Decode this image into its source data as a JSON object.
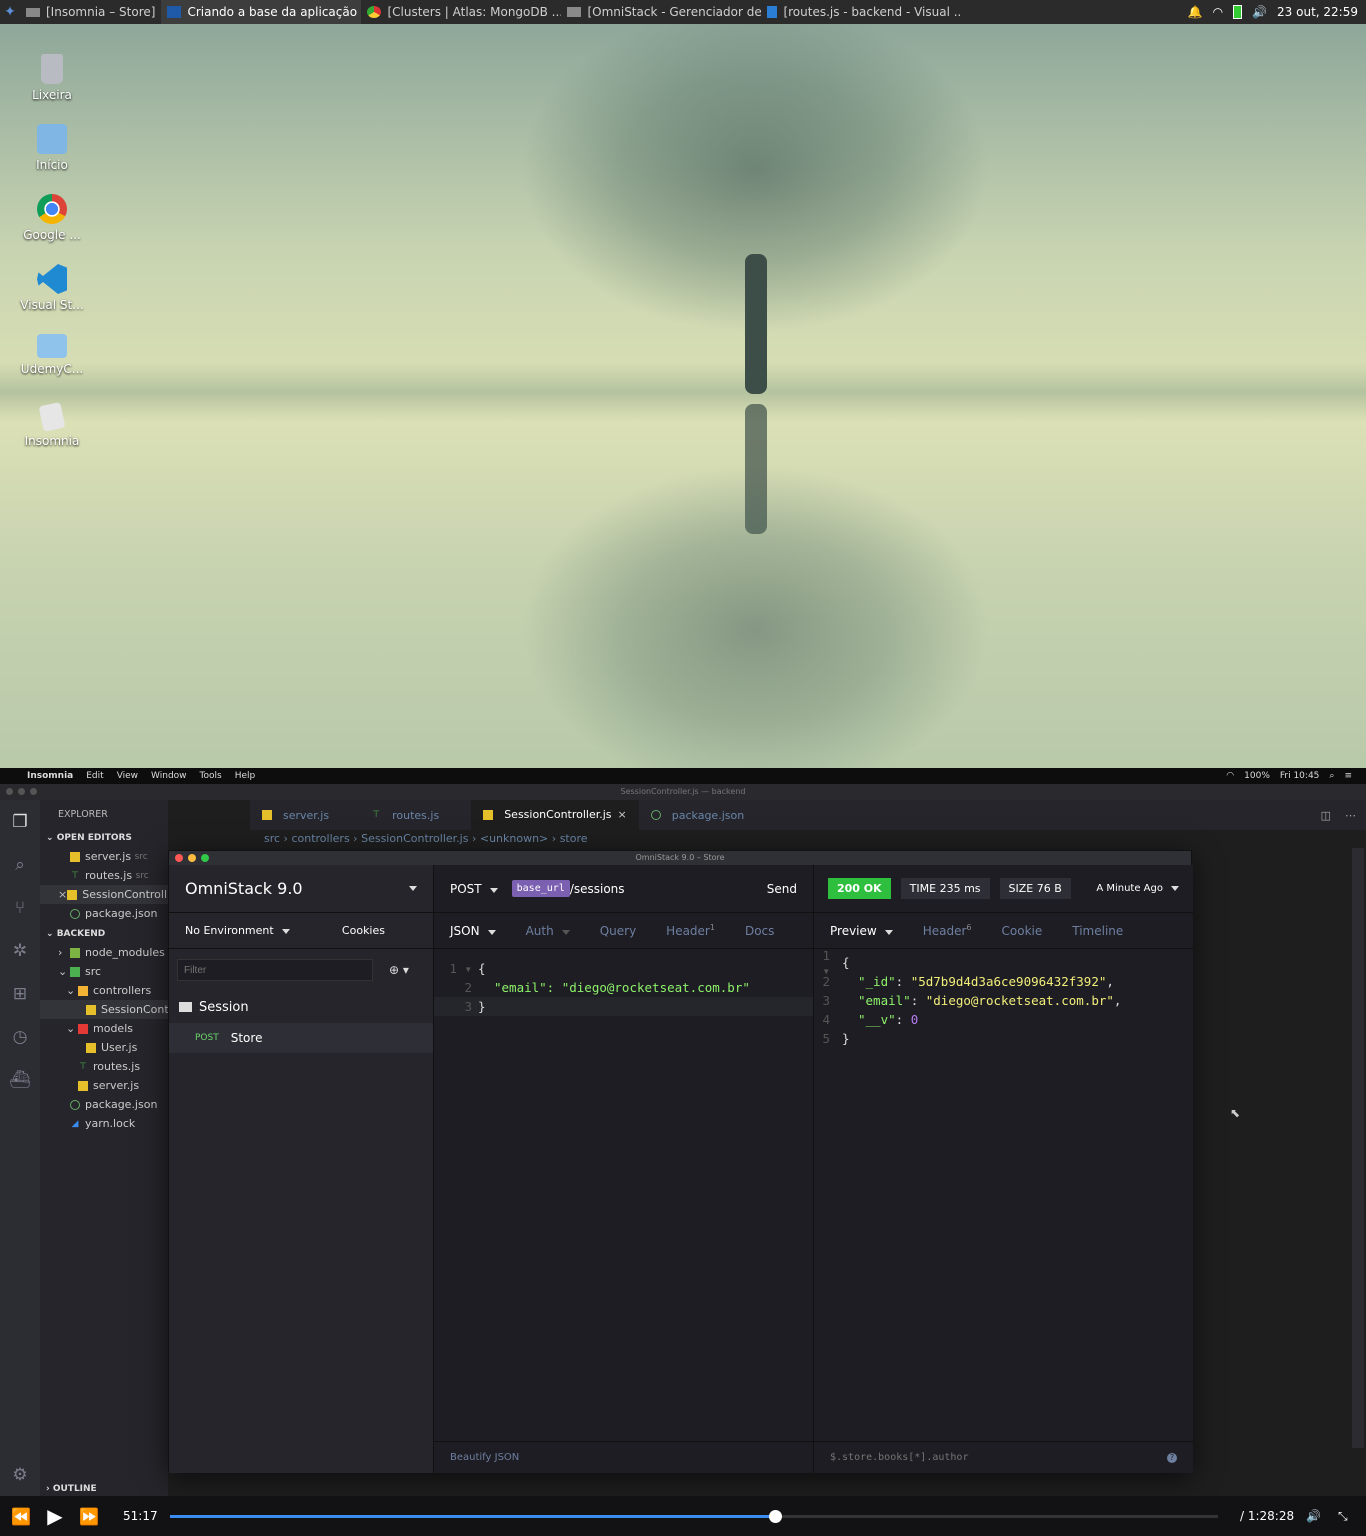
{
  "taskbar": {
    "items": [
      {
        "label": "[Insomnia – Store]",
        "active": false
      },
      {
        "label": "Criando a base da aplicação ...",
        "active": true
      },
      {
        "label": "[Clusters | Atlas: MongoDB ...",
        "active": false
      },
      {
        "label": "[OmniStack - Gerenciador de...",
        "active": false
      },
      {
        "label": "[routes.js - backend - Visual ...",
        "active": false
      }
    ],
    "clock": "23 out, 22:59"
  },
  "desktop_icons": [
    {
      "label": "Lixeira",
      "icon": "trash-icon"
    },
    {
      "label": "Início",
      "icon": "home-folder-icon"
    },
    {
      "label": "Google ...",
      "icon": "chrome-icon"
    },
    {
      "label": "Visual St...",
      "icon": "vscode-icon"
    },
    {
      "label": "UdemyC...",
      "icon": "folder-icon"
    },
    {
      "label": "Insomnia",
      "icon": "insomnia-icon"
    }
  ],
  "mac_menu": {
    "app": "Insomnia",
    "items": [
      "Edit",
      "View",
      "Window",
      "Tools",
      "Help"
    ],
    "battery": "100%",
    "time": "Fri 10:45"
  },
  "vscode": {
    "window_title": "SessionController.js — backend",
    "explorer_label": "EXPLORER",
    "open_editors_label": "OPEN EDITORS",
    "open_editors": [
      {
        "name": "server.js",
        "hint": "src"
      },
      {
        "name": "routes.js",
        "hint": "src"
      },
      {
        "name": "SessionControll...",
        "hint": ""
      },
      {
        "name": "package.json",
        "hint": ""
      }
    ],
    "backend_label": "BACKEND",
    "tree": [
      {
        "name": "node_modules",
        "indent": 1
      },
      {
        "name": "src",
        "indent": 1
      },
      {
        "name": "controllers",
        "indent": 2
      },
      {
        "name": "SessionContr...",
        "indent": 3
      },
      {
        "name": "models",
        "indent": 2
      },
      {
        "name": "User.js",
        "indent": 3
      },
      {
        "name": "routes.js",
        "indent": 2
      },
      {
        "name": "server.js",
        "indent": 2
      },
      {
        "name": "package.json",
        "indent": 1
      },
      {
        "name": "yarn.lock",
        "indent": 1
      }
    ],
    "outline_label": "OUTLINE",
    "tabs": [
      {
        "label": "server.js",
        "active": false
      },
      {
        "label": "routes.js",
        "active": false
      },
      {
        "label": "SessionController.js",
        "active": true
      },
      {
        "label": "package.json",
        "active": false
      }
    ],
    "breadcrumbs": [
      "src",
      "controllers",
      "SessionController.js",
      "<unknown>",
      "store"
    ]
  },
  "insomnia": {
    "window_title": "OmniStack 9.0 – Store",
    "workspace": "OmniStack 9.0",
    "environment": "No Environment",
    "cookies": "Cookies",
    "filter_placeholder": "Filter",
    "folder": "Session",
    "request_method": "POST",
    "request_name": "Store",
    "method": "POST",
    "url_var": "base_url",
    "url_path": "/sessions",
    "send": "Send",
    "req_tabs": [
      {
        "label": "JSON",
        "active": true
      },
      {
        "label": "Auth",
        "active": false
      },
      {
        "label": "Query",
        "active": false
      },
      {
        "label": "Header",
        "active": false,
        "count": "1"
      },
      {
        "label": "Docs",
        "active": false
      }
    ],
    "body_lines": [
      "{",
      "\"email\": \"diego@rocketseat.com.br\"",
      "}"
    ],
    "beautify": "Beautify JSON",
    "status": "200 OK",
    "time": "TIME 235 ms",
    "size": "SIZE 76 B",
    "when": "A Minute Ago",
    "res_tabs": [
      {
        "label": "Preview",
        "active": true
      },
      {
        "label": "Header",
        "active": false,
        "count": "6"
      },
      {
        "label": "Cookie",
        "active": false
      },
      {
        "label": "Timeline",
        "active": false
      }
    ],
    "response": {
      "id_key": "\"_id\"",
      "id_val": "\"5d7b9d4d3a6ce9096432f392\"",
      "email_key": "\"email\"",
      "email_val": "\"diego@rocketseat.com.br\"",
      "v_key": "\"__v\"",
      "v_val": "0"
    },
    "filter_query": "$.store.books[*].author"
  },
  "player": {
    "current": "51:17",
    "total": "/ 1:28:28",
    "progress": 0.577
  },
  "colors": {
    "accent": "#3b8cf0",
    "ok": "#2fbf3f",
    "pill": "#7b5fb0"
  }
}
